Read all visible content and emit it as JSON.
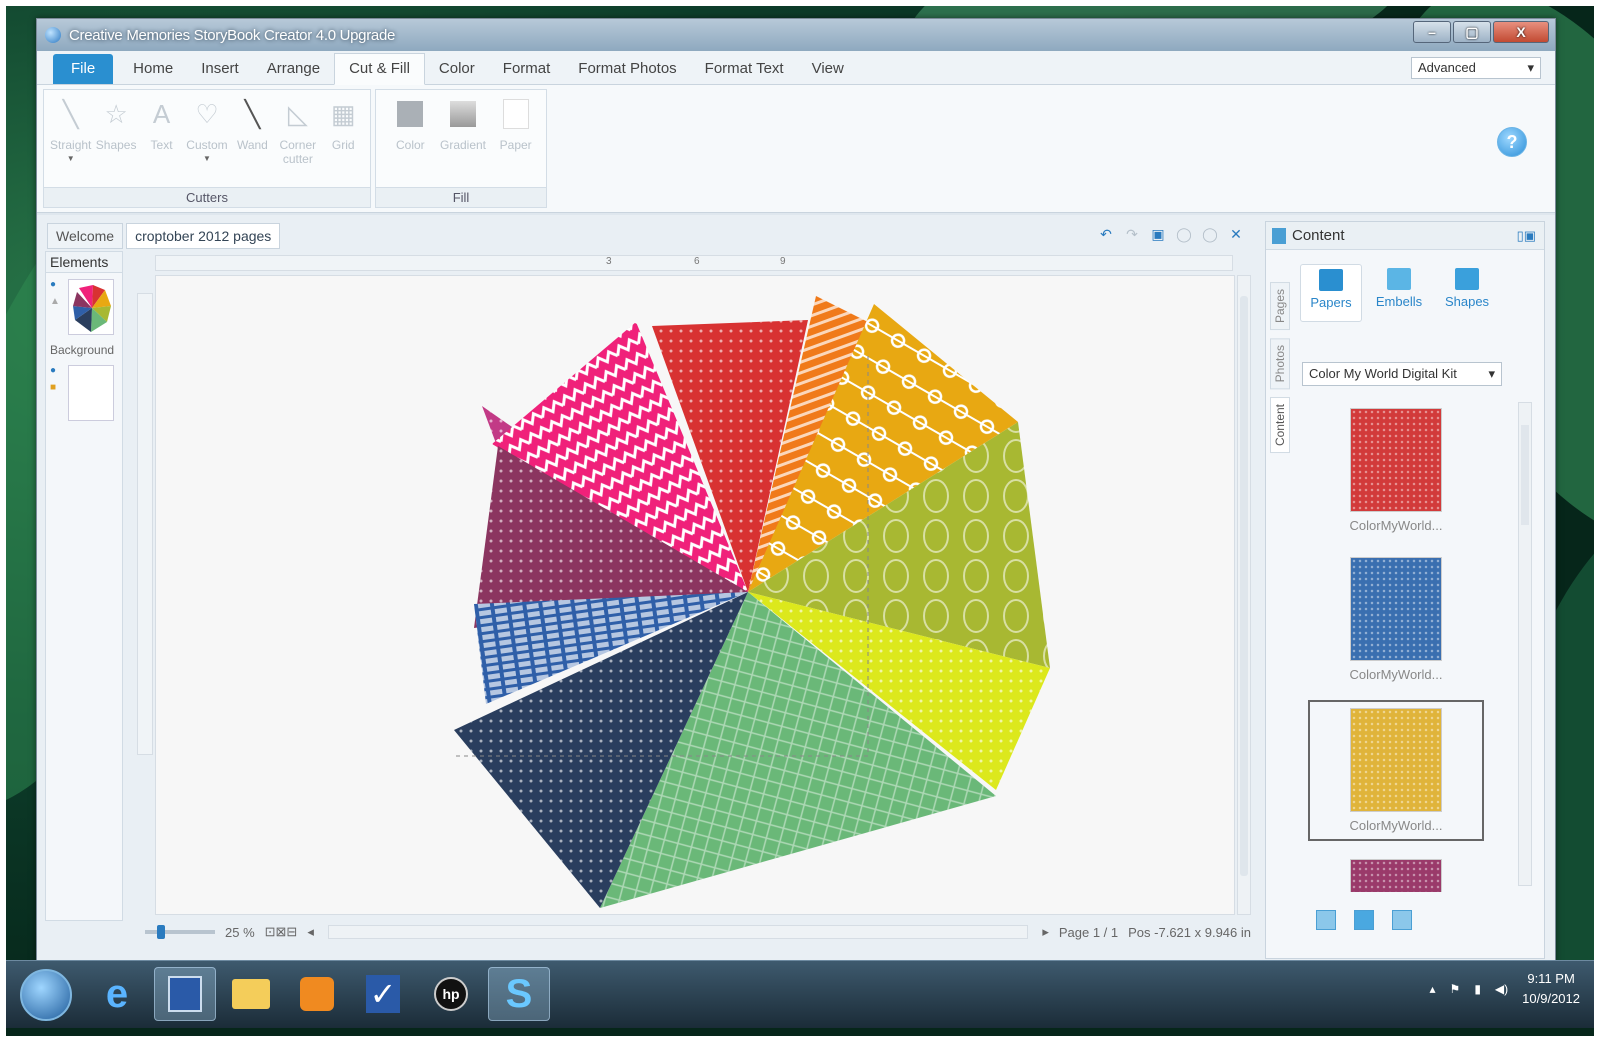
{
  "window": {
    "title": "Creative Memories StoryBook Creator 4.0 Upgrade",
    "controls": [
      "–",
      "▢",
      "X"
    ]
  },
  "ribbon": {
    "tabs": [
      "File",
      "Home",
      "Insert",
      "Arrange",
      "Cut & Fill",
      "Color",
      "Format",
      "Format Photos",
      "Format Text",
      "View"
    ],
    "active_tab": "Cut & Fill",
    "mode": "Advanced",
    "cutters": {
      "label": "Cutters",
      "tools": [
        {
          "line1": "Straight",
          "line2": ""
        },
        {
          "line1": "Shapes",
          "line2": ""
        },
        {
          "line1": "Text",
          "line2": ""
        },
        {
          "line1": "Custom",
          "line2": ""
        },
        {
          "line1": "Wand",
          "line2": ""
        },
        {
          "line1": "Corner",
          "line2": "cutter"
        },
        {
          "line1": "Grid",
          "line2": ""
        }
      ]
    },
    "fill": {
      "label": "Fill",
      "tools": [
        "Color",
        "Gradient",
        "Paper"
      ]
    },
    "help": "?"
  },
  "document": {
    "tabs": [
      "Welcome",
      "croptober 2012 pages"
    ],
    "active_tab": "croptober 2012 pages",
    "elements_title": "Elements",
    "background_label": "Background",
    "ruler_marks": [
      "3",
      "6",
      "9"
    ]
  },
  "status": {
    "zoom": "25 %",
    "page": "Page 1 / 1",
    "position": "Pos -7.621 x 9.946 in"
  },
  "content_panel": {
    "title": "Content",
    "side_tabs": [
      "Pages",
      "Photos",
      "Content"
    ],
    "categories": [
      "Papers",
      "Embells",
      "Shapes"
    ],
    "kit": "Color My World Digital Kit",
    "papers": [
      {
        "label": "ColorMyWorld...",
        "color": "#d23a3a",
        "selected": false
      },
      {
        "label": "ColorMyWorld...",
        "color": "#3a6fb0",
        "selected": false
      },
      {
        "label": "ColorMyWorld...",
        "color": "#e0b43a",
        "selected": true
      },
      {
        "label": "",
        "color": "#9a3a6a",
        "selected": false
      }
    ]
  },
  "taskbar": {
    "time": "9:11 PM",
    "date": "10/9/2012"
  },
  "colors": {
    "accent": "#2a8fd0",
    "pink": "#f0217a",
    "magenta": "#c23a86",
    "plum": "#8b3560",
    "red": "#d83232",
    "orange": "#f07a1a",
    "gold": "#e8a812",
    "olive": "#a8b832",
    "lime": "#dce81c",
    "green": "#6ab878",
    "navy": "#2a3e5e",
    "blue": "#2f5fa8"
  }
}
